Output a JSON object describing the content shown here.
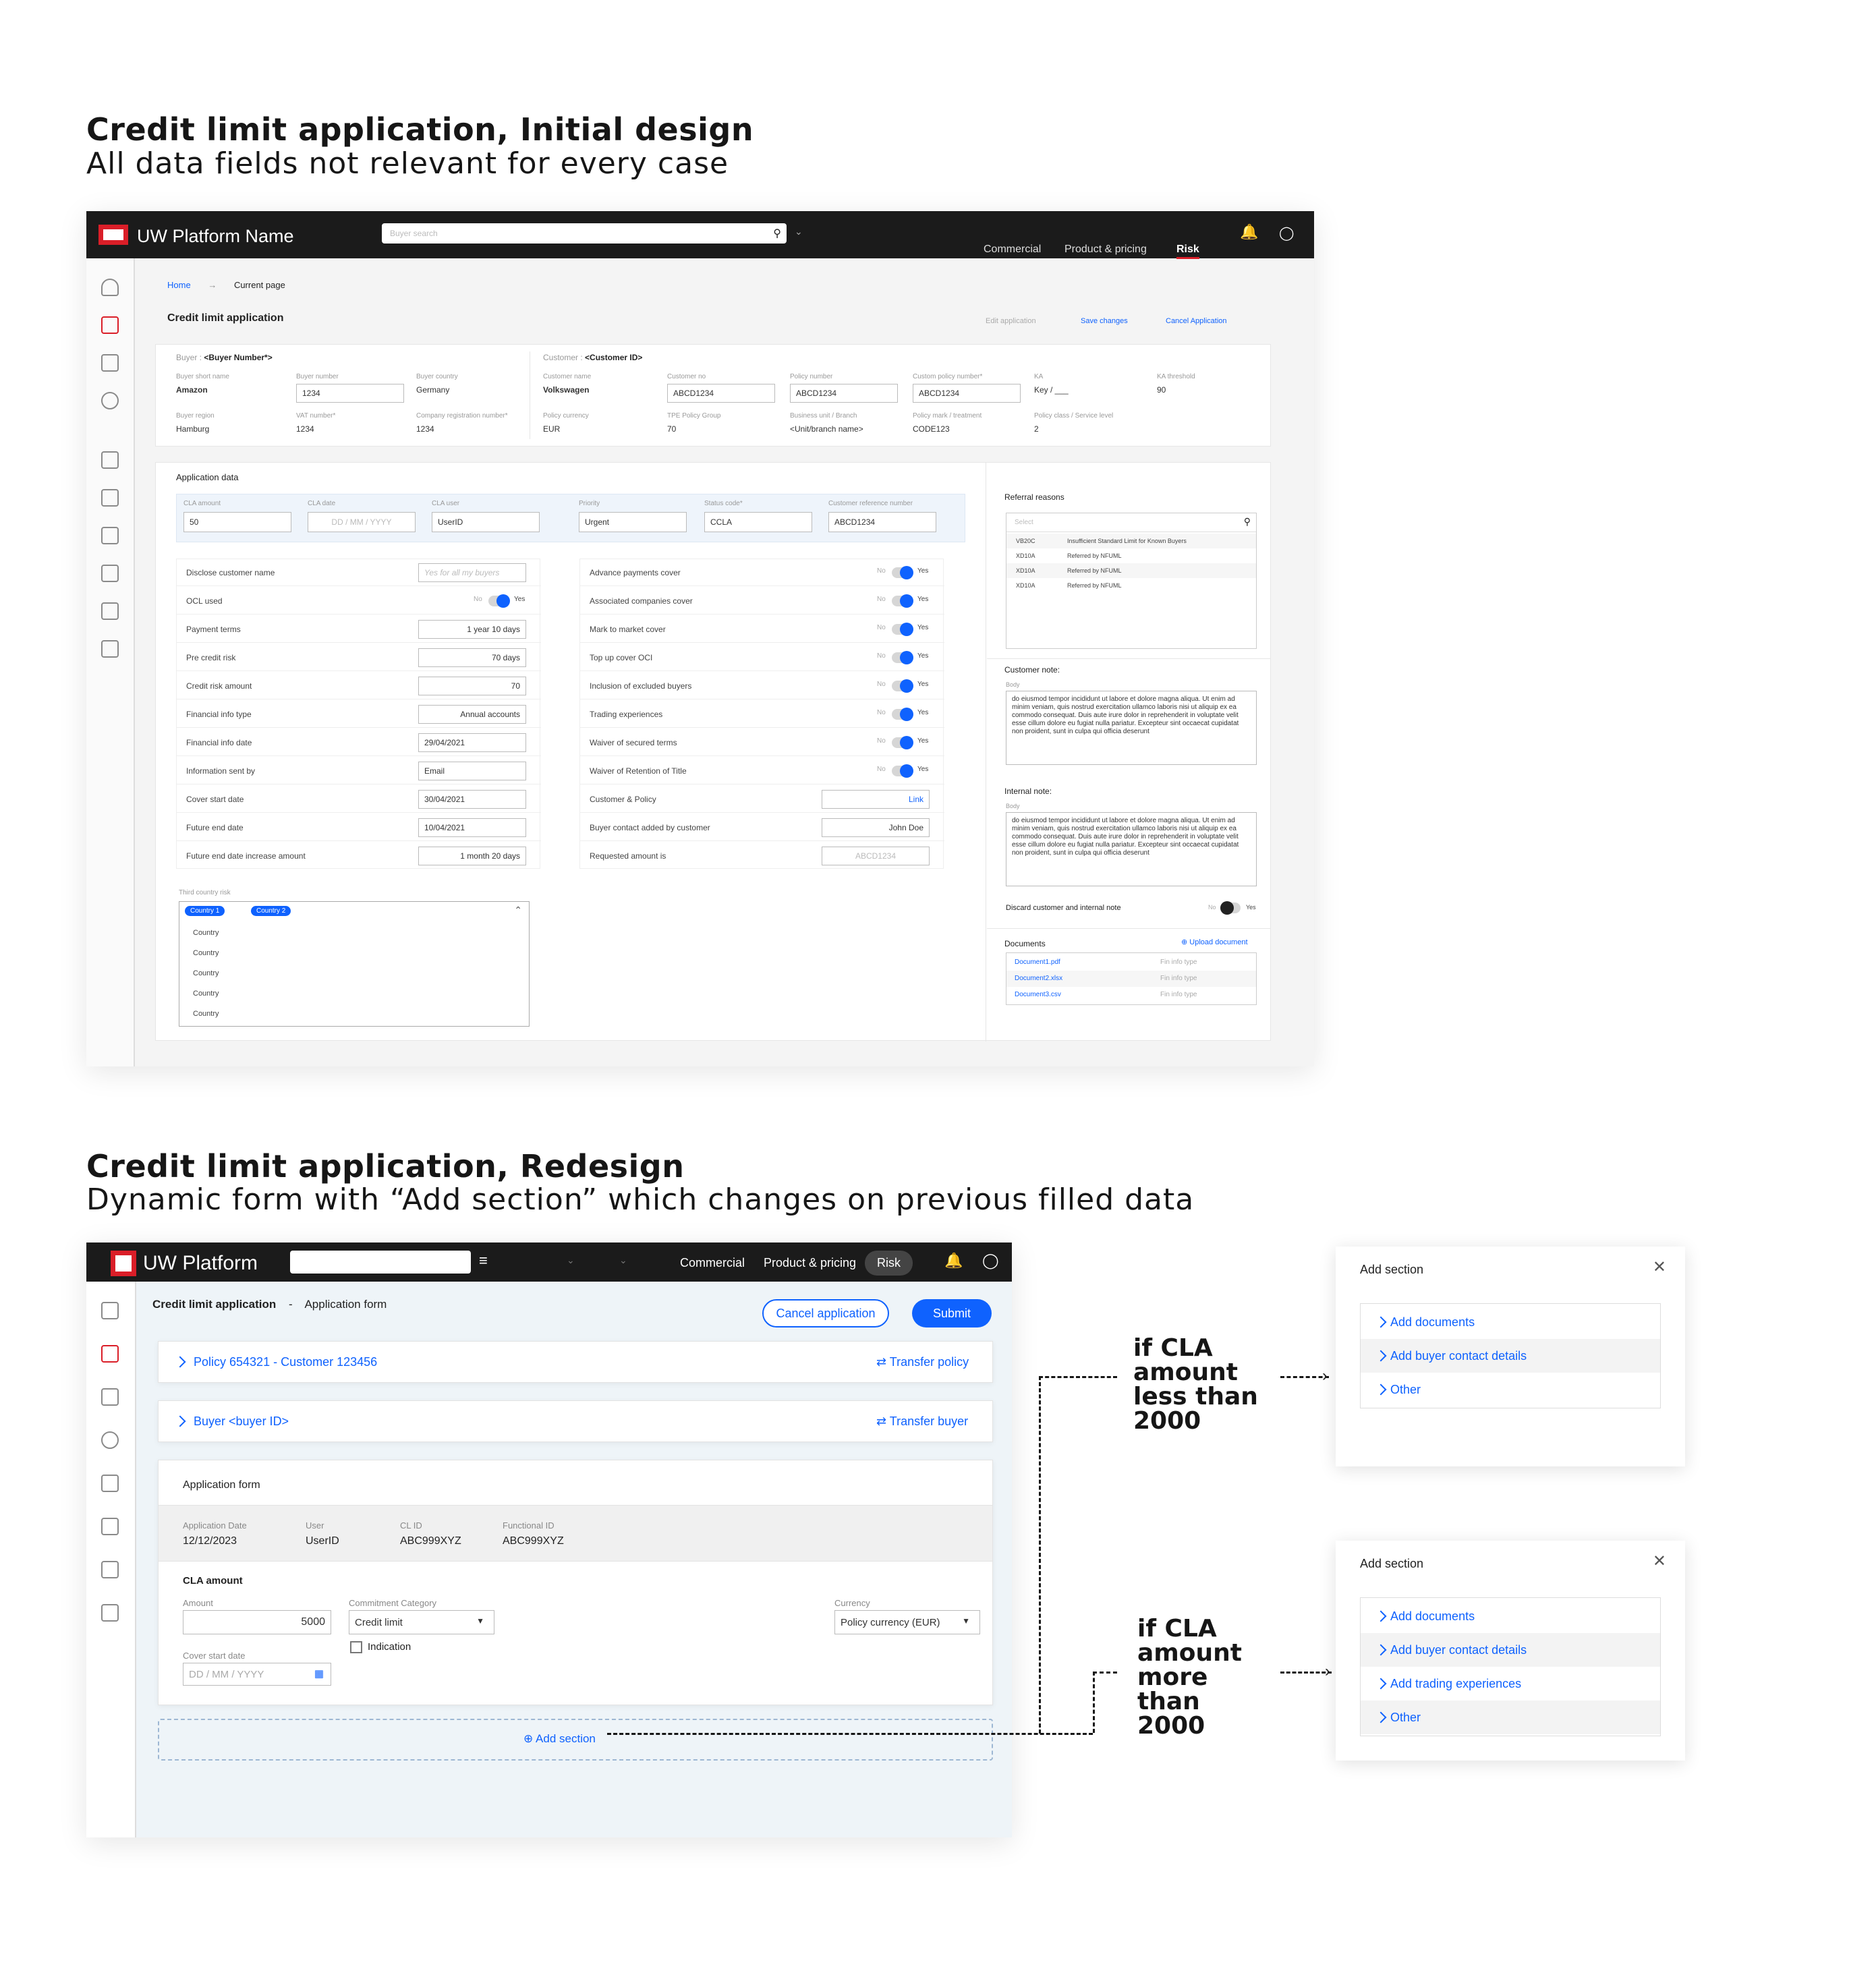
{
  "section1": {
    "title": "Credit limit application, Initial design",
    "subtitle": "All data fields not relevant for every case",
    "app": {
      "brand": "UW Platform Name",
      "search_placeholder": "Buyer search",
      "nav": [
        "Commercial",
        "Product & pricing",
        "Risk"
      ],
      "breadcrumb_home": "Home",
      "breadcrumb_current": "Current page",
      "page_title": "Credit limit application",
      "actions": [
        "Edit application",
        "Save changes",
        "Cancel Application"
      ],
      "buyer_header_label": "Buyer :",
      "buyer_header_value": "<Buyer Number*>",
      "customer_header_label": "Customer :",
      "customer_header_value": "<Customer ID>",
      "buyer_fields": [
        {
          "label": "Buyer short name",
          "value": "Amazon"
        },
        {
          "label": "Buyer number",
          "value": "1234"
        },
        {
          "label": "Buyer country",
          "value": "Germany"
        },
        {
          "label": "Buyer region",
          "value": "Hamburg"
        },
        {
          "label": "VAT number*",
          "value": "1234"
        },
        {
          "label": "Company registration number*",
          "value": "1234"
        }
      ],
      "customer_fields": [
        {
          "label": "Customer name",
          "value": "Volkswagen"
        },
        {
          "label": "Customer no",
          "value": "ABCD1234"
        },
        {
          "label": "Policy number",
          "value": "ABCD1234"
        },
        {
          "label": "Custom policy number*",
          "value": "ABCD1234"
        },
        {
          "label": "KA",
          "value": "Key / ___"
        },
        {
          "label": "KA threshold",
          "value": "90"
        },
        {
          "label": "Policy currency",
          "value": "EUR"
        },
        {
          "label": "TPE Policy Group",
          "value": "70"
        },
        {
          "label": "Business unit / Branch",
          "value": "<Unit/branch name>"
        },
        {
          "label": "Policy mark / treatment",
          "value": "CODE123"
        },
        {
          "label": "Policy class / Service level",
          "value": "2"
        }
      ],
      "application_data_title": "Application data",
      "app_fields": [
        {
          "label": "CLA amount",
          "value": "50"
        },
        {
          "label": "CLA date",
          "value": "DD / MM / YYYY"
        },
        {
          "label": "CLA user",
          "value": "UserID"
        },
        {
          "label": "Priority",
          "value": "Urgent"
        },
        {
          "label": "Status code*",
          "value": "CCLA"
        },
        {
          "label": "Customer reference number",
          "value": "ABCD1234"
        }
      ],
      "left_rows": [
        {
          "label": "Disclose customer name",
          "value": "Yes for all my buyers"
        },
        {
          "label": "OCL used",
          "value": "Yes"
        },
        {
          "label": "Payment terms",
          "value": "1 year 10 days"
        },
        {
          "label": "Pre credit risk",
          "value": "70 days"
        },
        {
          "label": "Credit risk amount",
          "value": "70"
        },
        {
          "label": "Financial info type",
          "value": "Annual accounts"
        },
        {
          "label": "Financial info date",
          "value": "29/04/2021"
        },
        {
          "label": "Information sent by",
          "value": "Email"
        },
        {
          "label": "Cover start date",
          "value": "30/04/2021"
        },
        {
          "label": "Future end date",
          "value": "10/04/2021"
        },
        {
          "label": "Future end date increase amount",
          "value": "1 month 20 days"
        }
      ],
      "right_rows": [
        {
          "label": "Advance payments cover",
          "value": "Yes"
        },
        {
          "label": "Associated companies cover",
          "value": "Yes"
        },
        {
          "label": "Mark to market cover",
          "value": "Yes"
        },
        {
          "label": "Top up cover OCI",
          "value": "Yes"
        },
        {
          "label": "Inclusion of excluded buyers",
          "value": "Yes"
        },
        {
          "label": "Trading experiences",
          "value": "Yes"
        },
        {
          "label": "Waiver of secured terms",
          "value": "Yes"
        },
        {
          "label": "Waiver of Retention of Title",
          "value": "Yes"
        },
        {
          "label": "Customer & Policy",
          "value": "Link"
        },
        {
          "label": "Buyer contact added by customer",
          "value": "John Doe"
        },
        {
          "label": "Requested amount is",
          "value": "ABCD1234"
        }
      ],
      "toggle_no": "No",
      "third_country_label": "Third country risk",
      "third_country_tags": [
        "Country 1",
        "Country 2"
      ],
      "third_country_options": [
        "Country",
        "Country",
        "Country",
        "Country",
        "Country"
      ],
      "referral_title": "Referral reasons",
      "referral_select": "Select",
      "referrals": [
        {
          "code": "VB20C",
          "text": "Insufficient Standard Limit for Known Buyers"
        },
        {
          "code": "XD10A",
          "text": "Referred by NFUML"
        },
        {
          "code": "XD10A",
          "text": "Referred by NFUML"
        },
        {
          "code": "XD10A",
          "text": "Referred by NFUML"
        }
      ],
      "customer_note_title": "Customer note:",
      "internal_note_title": "Internal note:",
      "body_label": "Body",
      "note_text": "do eiusmod tempor incididunt ut labore et dolore magna aliqua. Ut enim ad minim veniam, quis nostrud exercitation ullamco laboris nisi ut aliquip ex ea commodo consequat. Duis aute irure dolor in reprehenderit in voluptate velit esse cillum dolore eu fugiat nulla pariatur. Excepteur sint occaecat cupidatat non proident, sunt in culpa qui officia deserunt",
      "discard_label": "Discard customer and internal note",
      "discard_value": "Yes",
      "documents_title": "Documents",
      "upload_label": "Upload document",
      "documents": [
        {
          "name": "Document1.pdf",
          "type": "Fin info type"
        },
        {
          "name": "Document2.xlsx",
          "type": "Fin info type"
        },
        {
          "name": "Document3.csv",
          "type": "Fin info type"
        }
      ]
    }
  },
  "section2": {
    "title": "Credit limit application, Redesign",
    "subtitle": "Dynamic form with “Add section” which changes on previous filled data",
    "app": {
      "brand": "UW Platform",
      "nav": [
        "Commercial",
        "Product & pricing",
        "Risk"
      ],
      "page_title": "Credit limit application",
      "breadcrumb_sep": "-",
      "page_sub": "Application form",
      "cancel_label": "Cancel application",
      "submit_label": "Submit",
      "policy_row": "Policy 654321 - Customer 123456",
      "transfer_policy": "Transfer policy",
      "buyer_row": "Buyer <buyer ID>",
      "transfer_buyer": "Transfer buyer",
      "form_title": "Application form",
      "meta": [
        {
          "label": "Application Date",
          "value": "12/12/2023"
        },
        {
          "label": "User",
          "value": "UserID"
        },
        {
          "label": "CL ID",
          "value": "ABC999XYZ"
        },
        {
          "label": "Functional ID",
          "value": "ABC999XYZ"
        }
      ],
      "cla_title": "CLA amount",
      "amount_label": "Amount",
      "amount_value": "5000",
      "commitment_label": "Commitment Category",
      "commitment_value": "Credit limit",
      "indication_label": "Indication",
      "currency_label": "Currency",
      "currency_value": "Policy currency (EUR)",
      "cover_label": "Cover start date",
      "cover_placeholder": "DD / MM / YYYY",
      "add_section": "Add section"
    },
    "annotation_less": "if CLA amount less than 2000",
    "annotation_more": "if CLA amount more than 2000",
    "panel_less": {
      "title": "Add section",
      "items": [
        "Add documents",
        "Add buyer contact details",
        "Other"
      ]
    },
    "panel_more": {
      "title": "Add section",
      "items": [
        "Add documents",
        "Add buyer contact details",
        "Add trading experiences",
        "Other"
      ]
    }
  },
  "colors": {
    "accent": "#0f62fe",
    "brand_red": "#da1e28",
    "topbar": "#1b1b1b"
  }
}
